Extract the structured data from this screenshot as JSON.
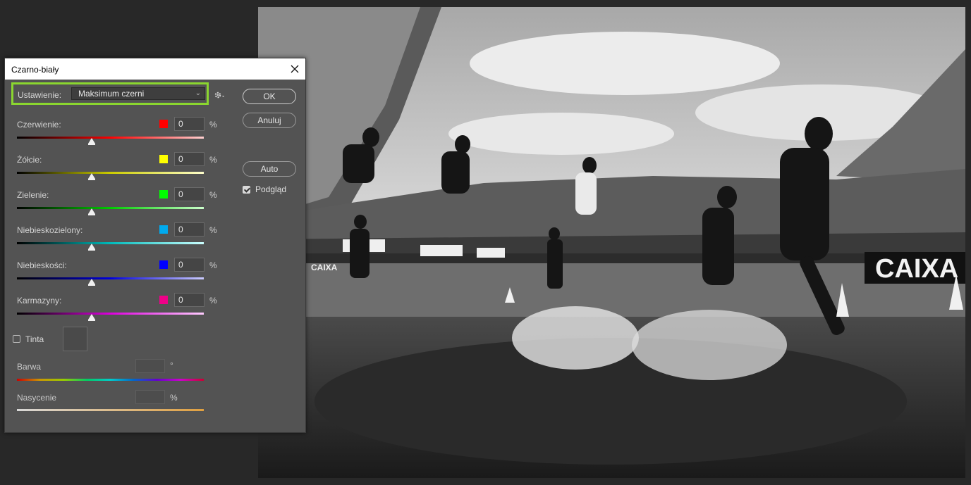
{
  "dialog": {
    "title": "Czarno-biały",
    "preset": {
      "label": "Ustawienie:",
      "value": "Maksimum czerni"
    },
    "buttons": {
      "ok": "OK",
      "cancel": "Anuluj",
      "auto": "Auto"
    },
    "preview": {
      "label": "Podgląd",
      "checked": true
    },
    "sliders": [
      {
        "label": "Czerwienie:",
        "value": "0",
        "unit": "%",
        "color": "#ff0000"
      },
      {
        "label": "Żółcie:",
        "value": "0",
        "unit": "%",
        "color": "#ffff00"
      },
      {
        "label": "Zielenie:",
        "value": "0",
        "unit": "%",
        "color": "#00ff00"
      },
      {
        "label": "Niebieskozielony:",
        "value": "0",
        "unit": "%",
        "color": "#00aaee"
      },
      {
        "label": "Niebieskości:",
        "value": "0",
        "unit": "%",
        "color": "#0000ff"
      },
      {
        "label": "Karmazyny:",
        "value": "0",
        "unit": "%",
        "color": "#ee0088"
      }
    ],
    "tint": {
      "label": "Tinta",
      "checked": false
    },
    "hue": {
      "label": "Barwa",
      "unit": "°"
    },
    "saturation": {
      "label": "Nasycenie",
      "unit": "%"
    }
  },
  "canvas": {
    "banner_left": "CAIXA",
    "banner_right": "CAIXA"
  },
  "icons": {
    "close": "close-icon",
    "gear": "gear-icon",
    "chevron": "chevron-down-icon"
  }
}
